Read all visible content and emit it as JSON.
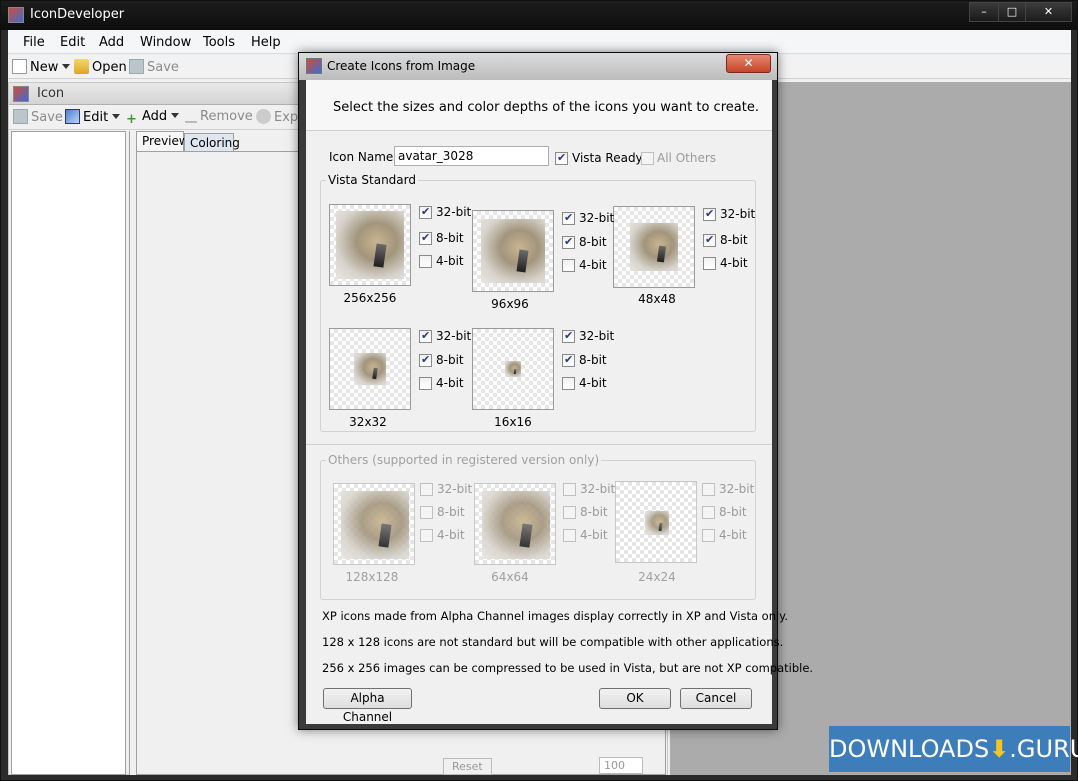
{
  "app": {
    "title": "IconDeveloper"
  },
  "window_controls": {
    "minimize": "–",
    "maximize": "□",
    "close": "✕"
  },
  "menu": [
    "File",
    "Edit",
    "Add",
    "Window",
    "Tools",
    "Help"
  ],
  "toolbar": {
    "new": "New",
    "open": "Open",
    "save": "Save"
  },
  "doc": {
    "title": "Icon",
    "toolbar": {
      "save": "Save",
      "edit": "Edit",
      "add": "Add",
      "remove": "Remove",
      "export": "Expo"
    },
    "tabs": [
      "Preview",
      "Coloring"
    ],
    "bottom": {
      "reset": "Reset",
      "zoom": "100"
    }
  },
  "dialog": {
    "title": "Create Icons from Image",
    "close_label": "✕",
    "header": "Select the sizes and color depths of the icons you want to create.",
    "icon_name_label": "Icon Name:",
    "icon_name_value": "avatar_3028",
    "vista_ready": "Vista Ready",
    "all_others": "All Others",
    "vista_group": "Vista Standard",
    "others_group": "Others (supported in registered version only)",
    "depths": [
      "32-bit",
      "8-bit",
      "4-bit"
    ],
    "vista_sizes": [
      {
        "label": "256x256",
        "checks": [
          true,
          true,
          false
        ]
      },
      {
        "label": "96x96",
        "checks": [
          true,
          true,
          false
        ]
      },
      {
        "label": "48x48",
        "checks": [
          true,
          true,
          false
        ]
      },
      {
        "label": "32x32",
        "checks": [
          true,
          true,
          false
        ]
      },
      {
        "label": "16x16",
        "checks": [
          true,
          true,
          false
        ]
      }
    ],
    "other_sizes": [
      {
        "label": "128x128",
        "checks": [
          false,
          false,
          false
        ]
      },
      {
        "label": "64x64",
        "checks": [
          false,
          false,
          false
        ]
      },
      {
        "label": "24x24",
        "checks": [
          false,
          false,
          false
        ]
      }
    ],
    "notes": [
      "XP icons made from Alpha Channel images display correctly in XP and Vista only.",
      "128 x 128 icons are not standard but will be compatible with other applications.",
      "256 x 256 images  can be compressed to be used in Vista, but are not XP compatible."
    ],
    "buttons": {
      "alpha": "Alpha Channel",
      "ok": "OK",
      "cancel": "Cancel"
    }
  },
  "watermark": {
    "left": "DOWNLOADS",
    "right": ".GURU"
  }
}
